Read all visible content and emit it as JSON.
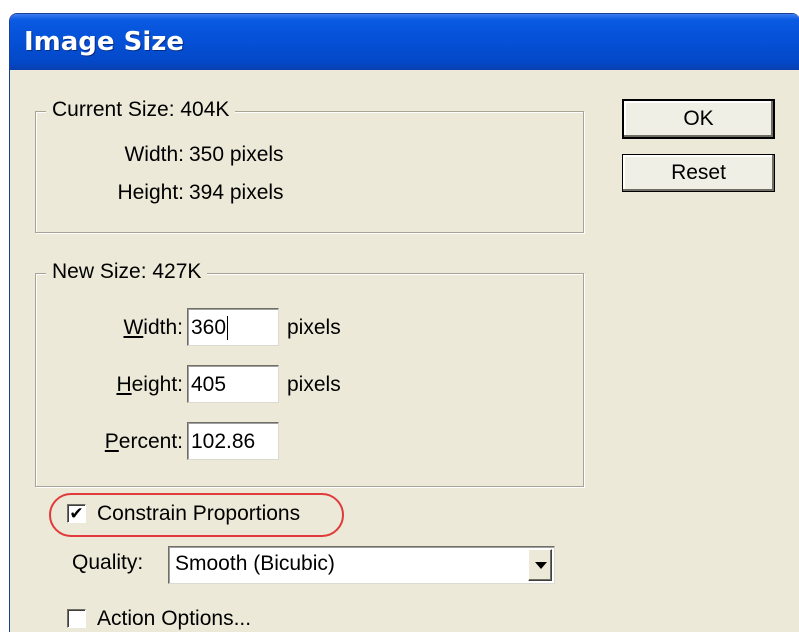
{
  "window": {
    "title": "Image Size"
  },
  "current_size": {
    "legend": "Current Size: 404K",
    "width_label": "Width:",
    "width_value": "350 pixels",
    "height_label": "Height:",
    "height_value": "394 pixels"
  },
  "new_size": {
    "legend": "New Size: 427K",
    "width_accel": "W",
    "width_rest": "idth:",
    "width_value": "360",
    "width_unit": "pixels",
    "height_accel": "H",
    "height_rest": "eight:",
    "height_value": "405",
    "height_unit": "pixels",
    "percent_accel": "P",
    "percent_rest": "ercent:",
    "percent_value": "102.86"
  },
  "constrain": {
    "label": "Constrain Proportions",
    "checked": true,
    "check_glyph": "✔"
  },
  "quality": {
    "label": "Quality:",
    "value": "Smooth (Bicubic)"
  },
  "action_options": {
    "label": "Action Options...",
    "checked": false
  },
  "buttons": {
    "ok": "OK",
    "reset": "Reset"
  },
  "colors": {
    "title_bar": "#0550d6",
    "dialog_bg": "#ece9d8",
    "highlight": "#e03a3a"
  }
}
